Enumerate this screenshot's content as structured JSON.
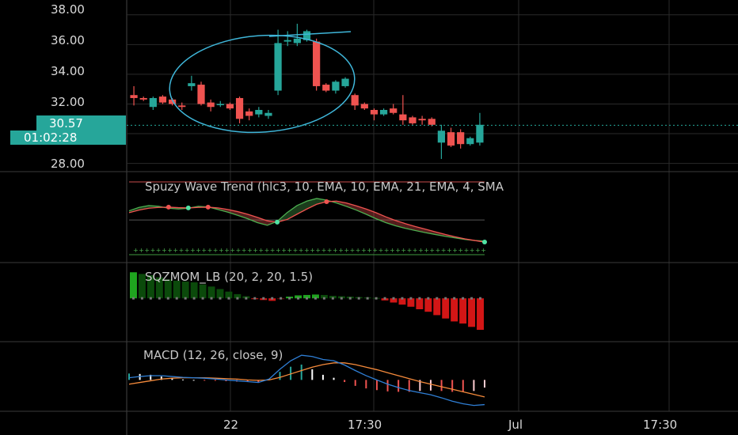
{
  "colors": {
    "up": "#26a69a",
    "down": "#ef5350",
    "grid": "#2a2a2a",
    "divider": "#3a3a3a",
    "axis_text": "#d9d9d9",
    "annotation": "#3fb6d9",
    "price_line": "#26a69a",
    "macd": "#2f7fd6",
    "signal": "#f58a3b",
    "wt1": "#4caf50",
    "wt2": "#ef5350",
    "sqz_up_strong": "#1fa51f",
    "sqz_up_weak": "#0b4a0b",
    "sqz_down_strong": "#d31616",
    "sqz_down_weak": "#6b0909"
  },
  "price_axis": {
    "ticks": [
      "38.00",
      "36.00",
      "34.00",
      "32.00",
      "28.00"
    ],
    "current_price": "30.57",
    "countdown": "01:02:28"
  },
  "time_axis": {
    "ticks": [
      "22",
      "17:30",
      "Jul",
      "17:30"
    ]
  },
  "indicators": {
    "wavetrend": "Spuzy Wave Trend (hlc3, 10, EMA, 10, EMA, 21, EMA, 4, SMA",
    "squeeze": "SQZMOM_LB (20, 2, 20, 1.5)",
    "macd": "MACD (12, 26, close, 9)"
  },
  "chart_data": [
    {
      "type": "candlestick",
      "title": "",
      "ylim": [
        27.5,
        39.0
      ],
      "candles": [
        {
          "o": 32.6,
          "h": 33.2,
          "l": 31.9,
          "c": 32.4
        },
        {
          "o": 32.4,
          "h": 32.5,
          "l": 32.2,
          "c": 32.3
        },
        {
          "o": 31.8,
          "h": 32.5,
          "l": 31.6,
          "c": 32.4
        },
        {
          "o": 32.5,
          "h": 32.6,
          "l": 32.0,
          "c": 32.1
        },
        {
          "o": 32.3,
          "h": 32.4,
          "l": 31.9,
          "c": 32.0
        },
        {
          "o": 31.9,
          "h": 32.1,
          "l": 31.6,
          "c": 31.8
        },
        {
          "o": 33.2,
          "h": 33.9,
          "l": 32.9,
          "c": 33.4
        },
        {
          "o": 33.3,
          "h": 33.5,
          "l": 31.9,
          "c": 32.0
        },
        {
          "o": 32.1,
          "h": 32.3,
          "l": 31.5,
          "c": 31.8
        },
        {
          "o": 32.0,
          "h": 32.2,
          "l": 31.8,
          "c": 32.0
        },
        {
          "o": 32.0,
          "h": 32.1,
          "l": 31.6,
          "c": 31.7
        },
        {
          "o": 32.4,
          "h": 32.5,
          "l": 30.7,
          "c": 31.0
        },
        {
          "o": 31.5,
          "h": 31.7,
          "l": 30.9,
          "c": 31.2
        },
        {
          "o": 31.3,
          "h": 31.8,
          "l": 31.1,
          "c": 31.6
        },
        {
          "o": 31.2,
          "h": 31.6,
          "l": 31.0,
          "c": 31.4
        },
        {
          "o": 32.9,
          "h": 37.0,
          "l": 32.6,
          "c": 36.1
        },
        {
          "o": 36.2,
          "h": 36.9,
          "l": 35.9,
          "c": 36.3
        },
        {
          "o": 36.1,
          "h": 37.4,
          "l": 35.9,
          "c": 36.4
        },
        {
          "o": 36.3,
          "h": 37.0,
          "l": 36.2,
          "c": 36.9
        },
        {
          "o": 36.2,
          "h": 36.4,
          "l": 32.9,
          "c": 33.2
        },
        {
          "o": 33.3,
          "h": 33.4,
          "l": 32.8,
          "c": 32.9
        },
        {
          "o": 32.9,
          "h": 33.6,
          "l": 32.7,
          "c": 33.5
        },
        {
          "o": 33.2,
          "h": 33.8,
          "l": 33.1,
          "c": 33.7
        },
        {
          "o": 32.6,
          "h": 32.7,
          "l": 31.6,
          "c": 31.9
        },
        {
          "o": 32.0,
          "h": 32.1,
          "l": 31.6,
          "c": 31.7
        },
        {
          "o": 31.6,
          "h": 31.7,
          "l": 30.9,
          "c": 31.3
        },
        {
          "o": 31.3,
          "h": 31.7,
          "l": 31.2,
          "c": 31.6
        },
        {
          "o": 31.7,
          "h": 32.0,
          "l": 31.3,
          "c": 31.4
        },
        {
          "o": 31.3,
          "h": 32.6,
          "l": 30.6,
          "c": 30.9
        },
        {
          "o": 31.1,
          "h": 31.2,
          "l": 30.6,
          "c": 30.7
        },
        {
          "o": 31.0,
          "h": 31.2,
          "l": 30.6,
          "c": 30.9
        },
        {
          "o": 31.0,
          "h": 31.1,
          "l": 30.5,
          "c": 30.6
        },
        {
          "o": 29.4,
          "h": 30.6,
          "l": 28.3,
          "c": 30.2
        },
        {
          "o": 30.1,
          "h": 30.4,
          "l": 29.1,
          "c": 29.2
        },
        {
          "o": 30.1,
          "h": 30.3,
          "l": 29.0,
          "c": 29.3
        },
        {
          "o": 29.3,
          "h": 29.8,
          "l": 29.2,
          "c": 29.7
        },
        {
          "o": 29.4,
          "h": 31.4,
          "l": 29.2,
          "c": 30.6
        }
      ]
    },
    {
      "type": "line",
      "name": "Spuzy Wave Trend",
      "ylim": [
        -1.2,
        1.0
      ],
      "series": [
        {
          "values": [
            0.35,
            0.48,
            0.55,
            0.52,
            0.45,
            0.42,
            0.45,
            0.52,
            0.5,
            0.4,
            0.3,
            0.18,
            0.05,
            -0.1,
            -0.2,
            -0.05,
            0.28,
            0.55,
            0.72,
            0.82,
            0.76,
            0.65,
            0.52,
            0.38,
            0.22,
            0.05,
            -0.1,
            -0.22,
            -0.32,
            -0.4,
            -0.48,
            -0.55,
            -0.62,
            -0.68,
            -0.74,
            -0.78,
            -0.8
          ]
        },
        {
          "values": [
            0.28,
            0.38,
            0.45,
            0.48,
            0.49,
            0.47,
            0.46,
            0.48,
            0.49,
            0.46,
            0.4,
            0.32,
            0.22,
            0.1,
            -0.03,
            -0.08,
            0.02,
            0.22,
            0.42,
            0.6,
            0.7,
            0.72,
            0.65,
            0.54,
            0.42,
            0.28,
            0.12,
            -0.02,
            -0.14,
            -0.25,
            -0.35,
            -0.45,
            -0.55,
            -0.64,
            -0.72,
            -0.78,
            -0.84
          ]
        }
      ]
    },
    {
      "type": "bar",
      "name": "SQZMOM_LB",
      "ylim": [
        -0.9,
        0.7
      ],
      "values": [
        0.62,
        0.58,
        0.55,
        0.5,
        0.45,
        0.42,
        0.4,
        0.38,
        0.33,
        0.28,
        0.22,
        0.16,
        0.1,
        0.05,
        -0.02,
        -0.04,
        -0.06,
        -0.02,
        0.04,
        0.07,
        0.08,
        0.09,
        0.08,
        0.06,
        0.05,
        0.04,
        0.03,
        0.02,
        0.01,
        -0.05,
        -0.1,
        -0.15,
        -0.2,
        -0.26,
        -0.32,
        -0.4,
        -0.48,
        -0.55,
        -0.6,
        -0.68,
        -0.75
      ]
    },
    {
      "type": "line",
      "name": "MACD",
      "ylim": [
        -0.7,
        0.75
      ],
      "series": [
        {
          "values": [
            0.05,
            0.08,
            0.1,
            0.1,
            0.08,
            0.06,
            0.05,
            0.04,
            0.02,
            0.0,
            -0.02,
            -0.04,
            -0.06,
            0.02,
            0.25,
            0.45,
            0.58,
            0.55,
            0.48,
            0.45,
            0.35,
            0.22,
            0.1,
            0.0,
            -0.1,
            -0.18,
            -0.25,
            -0.3,
            -0.35,
            -0.42,
            -0.5,
            -0.56,
            -0.6,
            -0.58
          ]
        },
        {
          "values": [
            -0.1,
            -0.06,
            -0.02,
            0.02,
            0.04,
            0.05,
            0.05,
            0.05,
            0.04,
            0.03,
            0.02,
            0.0,
            -0.01,
            0.0,
            0.06,
            0.14,
            0.22,
            0.3,
            0.36,
            0.4,
            0.4,
            0.36,
            0.3,
            0.24,
            0.17,
            0.1,
            0.03,
            -0.04,
            -0.1,
            -0.16,
            -0.22,
            -0.28,
            -0.34,
            -0.4
          ]
        }
      ],
      "histogram": [
        0.15,
        0.14,
        0.12,
        0.08,
        0.04,
        0.01,
        0.0,
        -0.01,
        -0.02,
        -0.03,
        -0.04,
        -0.04,
        -0.05,
        0.02,
        0.19,
        0.31,
        0.36,
        0.25,
        0.12,
        0.05,
        -0.05,
        -0.14,
        -0.2,
        -0.24,
        -0.27,
        -0.28,
        -0.28,
        -0.26,
        -0.25,
        -0.26,
        -0.28,
        -0.28,
        -0.26,
        -0.18
      ]
    }
  ]
}
